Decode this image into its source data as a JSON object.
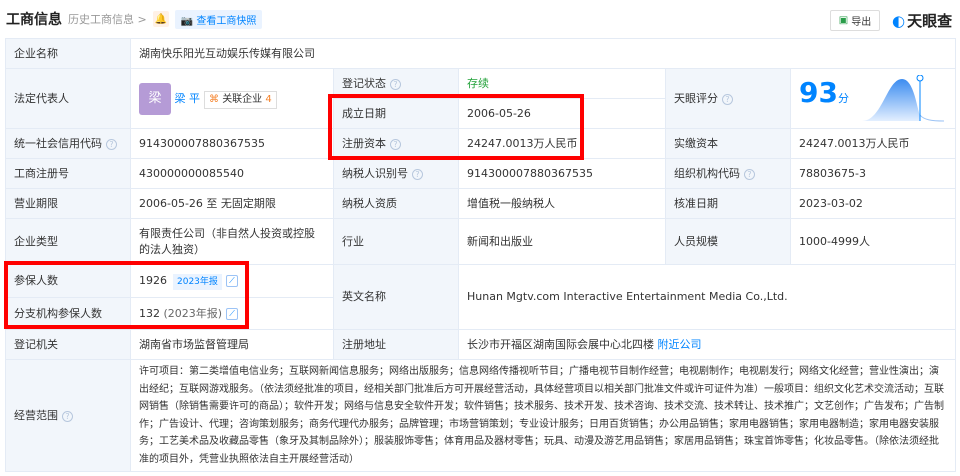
{
  "header": {
    "title": "工商信息",
    "history": "历史工商信息 >",
    "snapshot": "查看工商快照",
    "export": "导出",
    "logo": "天眼查"
  },
  "rows": {
    "company_name": {
      "label": "企业名称",
      "value": "湖南快乐阳光互动娱乐传媒有限公司"
    },
    "legal_rep": {
      "label": "法定代表人",
      "avatar": "梁",
      "name": "梁 平",
      "related": "关联企业",
      "related_count": "4"
    },
    "reg_status": {
      "label": "登记状态",
      "value": "存续"
    },
    "established": {
      "label": "成立日期",
      "value": "2006-05-26"
    },
    "reg_capital": {
      "label": "注册资本",
      "value": "24247.0013万人民币"
    },
    "score": {
      "label": "天眼评分",
      "value": "93",
      "unit": "分"
    },
    "credit_code": {
      "label": "统一社会信用代码",
      "value": "914300007880367535"
    },
    "paid_capital": {
      "label": "实缴资本",
      "value": "24247.0013万人民币"
    },
    "reg_no": {
      "label": "工商注册号",
      "value": "430000000085540"
    },
    "taxpayer_id": {
      "label": "纳税人识别号",
      "value": "914300007880367535"
    },
    "org_code": {
      "label": "组织机构代码",
      "value": "78803675-3"
    },
    "term": {
      "label": "营业期限",
      "value": "2006-05-26 至 无固定期限"
    },
    "taxpayer_qual": {
      "label": "纳税人资质",
      "value": "增值税一般纳税人"
    },
    "approval_date": {
      "label": "核准日期",
      "value": "2023-03-02"
    },
    "type": {
      "label": "企业类型",
      "value": "有限责任公司（非自然人投资或控股的法人独资）"
    },
    "industry": {
      "label": "行业",
      "value": "新闻和出版业"
    },
    "staff_size": {
      "label": "人员规模",
      "value": "1000-4999人"
    },
    "insured": {
      "label": "参保人数",
      "value": "1926",
      "tag": "2023年报"
    },
    "branch_insured": {
      "label": "分支机构参保人数",
      "value": "132",
      "year": "(2023年报)"
    },
    "english_name": {
      "label": "英文名称",
      "value": "Hunan Mgtv.com Interactive Entertainment Media Co.,Ltd."
    },
    "authority": {
      "label": "登记机关",
      "value": "湖南省市场监督管理局"
    },
    "address": {
      "label": "注册地址",
      "value": "长沙市开福区湖南国际会展中心北四楼",
      "nearby": "附近公司"
    },
    "scope": {
      "label": "经营范围",
      "value": "许可项目：第二类增值电信业务；互联网新闻信息服务；网络出版服务；信息网络传播视听节目；广播电视节目制作经营；电视剧制作；电视剧发行；网络文化经营；营业性演出；演出经纪；互联网游戏服务。（依法须经批准的项目，经相关部门批准后方可开展经营活动，具体经营项目以相关部门批准文件或许可证件为准）一般项目：组织文化艺术交流活动；互联网销售（除销售需要许可的商品）；软件开发；网络与信息安全软件开发；软件销售；技术服务、技术开发、技术咨询、技术交流、技术转让、技术推广；文艺创作；广告发布；广告制作；广告设计、代理；咨询策划服务；商务代理代办服务；品牌管理；市场营销策划；专业设计服务；日用百货销售；办公用品销售；家用电器销售；家用电器制造；家用电器安装服务；工艺美术品及收藏品零售（象牙及其制品除外）；服装服饰零售；体育用品及器材零售；玩具、动漫及游艺用品销售；家居用品销售；珠宝首饰零售；化妆品零售。（除依法须经批准的项目外，凭营业执照依法自主开展经营活动）"
    }
  },
  "colors": {
    "accent": "#0084ff",
    "highlight": "#ff0000",
    "status": "#23a23a"
  }
}
